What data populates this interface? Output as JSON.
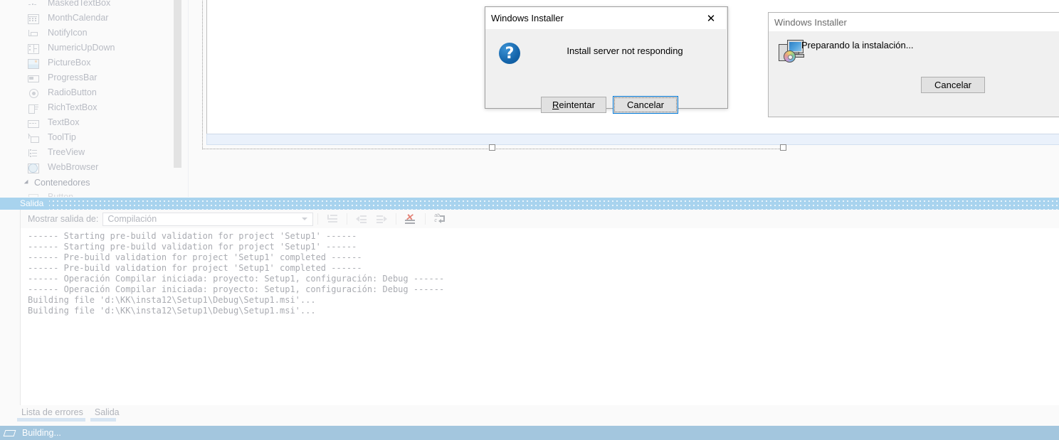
{
  "toolbox": {
    "items": [
      {
        "label": "MaskedTextBox",
        "icon": "masked-textbox-icon"
      },
      {
        "label": "MonthCalendar",
        "icon": "month-calendar-icon"
      },
      {
        "label": "NotifyIcon",
        "icon": "notify-icon-icon"
      },
      {
        "label": "NumericUpDown",
        "icon": "numeric-updown-icon"
      },
      {
        "label": "PictureBox",
        "icon": "picture-box-icon"
      },
      {
        "label": "ProgressBar",
        "icon": "progress-bar-icon"
      },
      {
        "label": "RadioButton",
        "icon": "radio-button-icon"
      },
      {
        "label": "RichTextBox",
        "icon": "rich-textbox-icon"
      },
      {
        "label": "TextBox",
        "icon": "textbox-icon"
      },
      {
        "label": "ToolTip",
        "icon": "tooltip-icon"
      },
      {
        "label": "TreeView",
        "icon": "treeview-icon"
      },
      {
        "label": "WebBrowser",
        "icon": "webbrowser-icon"
      }
    ],
    "group_label": "Contenedores",
    "partial_item_label": "Button"
  },
  "output": {
    "panel_title": "Salida",
    "show_output_from_label": "Mostrar salida de:",
    "selected_source": "Compilación",
    "lines": [
      "------ Starting pre-build validation for project 'Setup1' ------",
      "------ Starting pre-build validation for project 'Setup1' ------",
      "------ Pre-build validation for project 'Setup1' completed ------",
      "------ Pre-build validation for project 'Setup1' completed ------",
      "------ Operación Compilar iniciada: proyecto: Setup1, configuración: Debug ------",
      "------ Operación Compilar iniciada: proyecto: Setup1, configuración: Debug ------",
      "Building file 'd:\\KK\\insta12\\Setup1\\Debug\\Setup1.msi'...",
      "Building file 'd:\\KK\\insta12\\Setup1\\Debug\\Setup1.msi'..."
    ],
    "toolbar_icons": [
      "find-message-icon",
      "previous-message-icon",
      "next-message-icon",
      "clear-all-icon",
      "toggle-word-wrap-icon"
    ]
  },
  "bottom_tabs": [
    {
      "label": "Lista de errores"
    },
    {
      "label": "Salida"
    }
  ],
  "statusbar": {
    "text": "Building...",
    "icon": "build-status-icon",
    "background": "#a3c6de"
  },
  "dialog_error": {
    "title": "Windows Installer",
    "message": "Install server not responding",
    "icon": "question-mark-icon",
    "close_label": "✕",
    "buttons": [
      {
        "label": "Reintentar",
        "accelerator": "R",
        "focused": false
      },
      {
        "label": "Cancelar",
        "focused": true
      }
    ]
  },
  "dialog_progress": {
    "title": "Windows Installer",
    "message": "Preparando la instalación...",
    "icon": "installer-computer-disc-icon",
    "cancel_label": "Cancelar"
  },
  "colors": {
    "accent_blue": "#0078d7",
    "panel_header": "#a8d3ee",
    "statusbar": "#a3c6de",
    "icon_red": "#e06a5c"
  }
}
